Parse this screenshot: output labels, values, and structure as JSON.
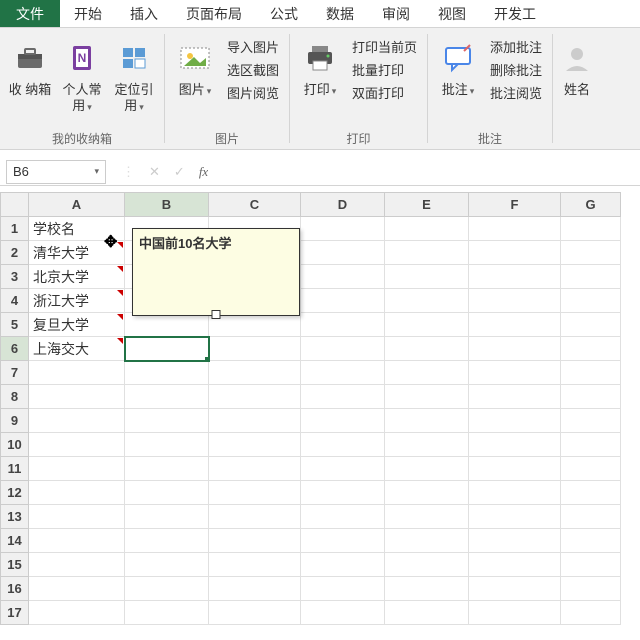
{
  "tabs": {
    "file": "文件",
    "home": "开始",
    "insert": "插入",
    "layout": "页面布局",
    "formula": "公式",
    "data": "数据",
    "review": "审阅",
    "view": "视图",
    "dev": "开发工"
  },
  "ribbon": {
    "inbox_btn": "收\n纳箱",
    "personal": "个人常\n用",
    "locate": "定位引\n用",
    "group_inbox": "我的收纳箱",
    "picture_btn": "图片",
    "import_pic": "导入图片",
    "crop_pic": "选区截图",
    "browse_pic": "图片阅览",
    "group_pic": "图片",
    "print_btn": "打印",
    "print_current": "打印当前页",
    "print_batch": "批量打印",
    "print_duplex": "双面打印",
    "group_print": "打印",
    "comment_btn": "批注",
    "add_comment": "添加批注",
    "del_comment": "删除批注",
    "read_comment": "批注阅览",
    "group_comment": "批注",
    "name_btn": "姓名"
  },
  "namebox": {
    "ref": "B6",
    "fx": "fx"
  },
  "cols": [
    "A",
    "B",
    "C",
    "D",
    "E",
    "F",
    "G"
  ],
  "rows": [
    "1",
    "2",
    "3",
    "4",
    "5",
    "6",
    "7",
    "8",
    "9",
    "10",
    "11",
    "12",
    "13",
    "14",
    "15",
    "16",
    "17"
  ],
  "cells": {
    "A1": "学校名",
    "A2": "清华大学",
    "A3": "北京大学",
    "A4": "浙江大学",
    "A5": "复旦大学",
    "A6": "上海交大"
  },
  "comment": {
    "text": "中国前10名大学"
  },
  "sel": {
    "col": "B",
    "row": "6"
  }
}
